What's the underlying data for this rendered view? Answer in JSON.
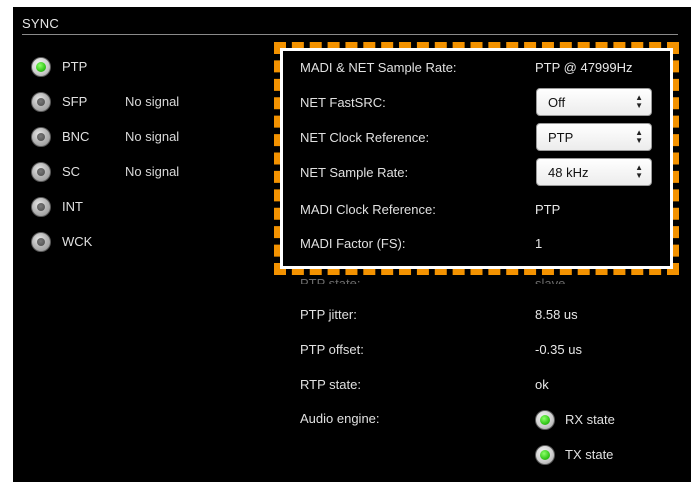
{
  "section": {
    "title": "SYNC"
  },
  "sources": [
    {
      "label": "PTP",
      "status": "",
      "active": true
    },
    {
      "label": "SFP",
      "status": "No signal",
      "active": false
    },
    {
      "label": "BNC",
      "status": "No signal",
      "active": false
    },
    {
      "label": "SC",
      "status": "No signal",
      "active": false
    },
    {
      "label": "INT",
      "status": "",
      "active": false
    },
    {
      "label": "WCK",
      "status": "",
      "active": false
    }
  ],
  "settings": {
    "madi_net_sample_rate": {
      "label": "MADI & NET Sample Rate:",
      "value": "PTP @ 47999Hz"
    },
    "net_fastsrc": {
      "label": "NET FastSRC:",
      "value": "Off"
    },
    "net_clock_reference": {
      "label": "NET Clock Reference:",
      "value": "PTP"
    },
    "net_sample_rate": {
      "label": "NET Sample Rate:",
      "value": "48 kHz"
    },
    "madi_clock_reference": {
      "label": "MADI Clock Reference:",
      "value": "PTP"
    },
    "madi_factor": {
      "label": "MADI Factor (FS):",
      "value": "1"
    }
  },
  "status": {
    "ptp_state": {
      "label": "PTP state:",
      "value": "slave"
    },
    "ptp_jitter": {
      "label": "PTP jitter:",
      "value": "8.58 us"
    },
    "ptp_offset": {
      "label": "PTP offset:",
      "value": "-0.35 us"
    },
    "rtp_state": {
      "label": "RTP state:",
      "value": "ok"
    },
    "audio_engine": {
      "label": "Audio engine:",
      "rx_state": "RX state",
      "tx_state": "TX state"
    }
  },
  "colors": {
    "highlight_border": "#f39200",
    "led_on": "#34c81a",
    "background": "#000000"
  }
}
